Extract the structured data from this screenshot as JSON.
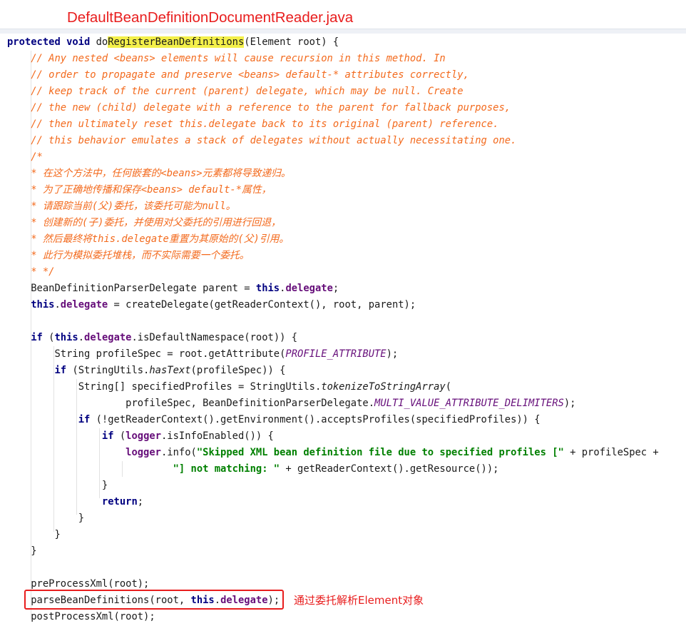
{
  "file_title": "DefaultBeanDefinitionDocumentReader.java",
  "note": "通过委托解析Element对象",
  "code": {
    "l1": {
      "mod": "protected void ",
      "name_pre": "do",
      "name_hl": "RegisterBeanDefinitions",
      "params": "(Element root) {"
    },
    "c1": "// Any nested <beans> elements will cause recursion in this method. In",
    "c2": "// order to propagate and preserve <beans> default-* attributes correctly,",
    "c3": "// keep track of the current (parent) delegate, which may be null. Create",
    "c4": "// the new (child) delegate with a reference to the parent for fallback purposes,",
    "c5": "// then ultimately reset this.delegate back to its original (parent) reference.",
    "c6": "// this behavior emulates a stack of delegates without actually necessitating one.",
    "c7": "/*",
    "c8": "* 在这个方法中，任何嵌套的<beans>元素都将导致递归。",
    "c9": "* 为了正确地传播和保存<beans> default-*属性，",
    "c10": "* 请跟踪当前(父)委托，该委托可能为null。",
    "c11": "* 创建新的(子)委托，并使用对父委托的引用进行回退，",
    "c12": "* 然后最终将this.delegate重置为其原始的(父)引用。",
    "c13": "* 此行为模拟委托堆栈，而不实际需要一个委托。",
    "c14": "* */",
    "s1": {
      "a": "BeanDefinitionParserDelegate parent = ",
      "this": "this",
      "dot": ".",
      "field": "delegate",
      "end": ";"
    },
    "s2": {
      "this": "this",
      "dot": ".",
      "field": "delegate",
      "b": " = createDelegate(getReaderContext(), root, parent);"
    },
    "s3": {
      "if": "if",
      "a": " (",
      "this": "this",
      "dot": ".",
      "field": "delegate",
      "b": ".isDefaultNamespace(root)) {"
    },
    "s4": {
      "a": "String profileSpec = root.getAttribute(",
      "const": "PROFILE_ATTRIBUTE",
      "b": ");"
    },
    "s5": {
      "if": "if",
      "a": " (StringUtils.",
      "method": "hasText",
      "b": "(profileSpec)) {"
    },
    "s6": {
      "a": "String[] specifiedProfiles = StringUtils.",
      "method": "tokenizeToStringArray",
      "b": "("
    },
    "s7": {
      "a": "profileSpec, BeanDefinitionParserDelegate.",
      "const": "MULTI_VALUE_ATTRIBUTE_DELIMITERS",
      "b": ");"
    },
    "s8": {
      "if": "if",
      "a": " (!getReaderContext().getEnvironment().acceptsProfiles(specifiedProfiles)) {"
    },
    "s9": {
      "if": "if",
      "a": " (",
      "field": "logger",
      "b": ".isInfoEnabled()) {"
    },
    "s10": {
      "field": "logger",
      "a": ".info(",
      "str": "\"Skipped XML bean definition file due to specified profiles [\"",
      "b": " + profileSpec +"
    },
    "s11": {
      "str": "\"] not matching: \"",
      "b": " + getReaderContext().getResource());"
    },
    "s12": "}",
    "s13": "return",
    "s13_end": ";",
    "s14": "}",
    "s15": "}",
    "s16": "}",
    "s17": "preProcessXml(root);",
    "s18": {
      "a": "parseBeanDefinitions(root, ",
      "this": "this",
      "dot": ".",
      "field": "delegate",
      "b": ");"
    },
    "s19": "postProcessXml(root);"
  }
}
